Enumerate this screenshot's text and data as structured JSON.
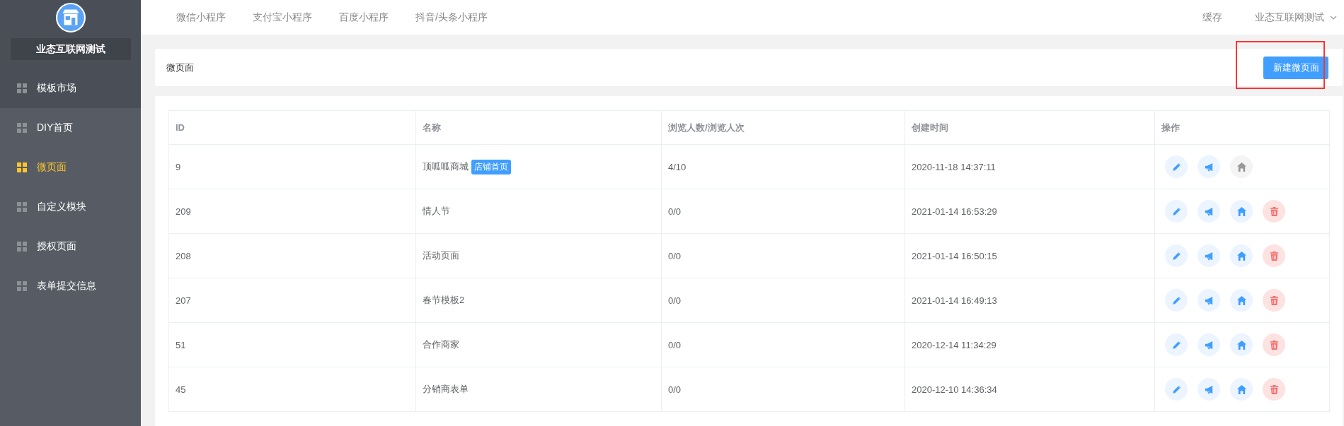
{
  "sidebar": {
    "shop_name": "业态互联网测试",
    "items": [
      {
        "label": "模板市场",
        "selected": false,
        "hovered": true
      },
      {
        "label": "DIY首页",
        "selected": false,
        "hovered": false
      },
      {
        "label": "微页面",
        "selected": true,
        "hovered": false
      },
      {
        "label": "自定义模块",
        "selected": false,
        "hovered": false
      },
      {
        "label": "授权页面",
        "selected": false,
        "hovered": false
      },
      {
        "label": "表单提交信息",
        "selected": false,
        "hovered": false
      }
    ]
  },
  "top_nav": {
    "tabs": [
      "微信小程序",
      "支付宝小程序",
      "百度小程序",
      "抖音/头条小程序"
    ],
    "cache": "缓存",
    "account": "业态互联网测试"
  },
  "page_header": {
    "title": "微页面",
    "new_button": "新建微页面",
    "highlighted": true
  },
  "table": {
    "columns": [
      "ID",
      "名称",
      "浏览人数/浏览人次",
      "创建时间",
      "操作"
    ],
    "rows": [
      {
        "id": "9",
        "name": "顶呱呱商城",
        "tag": "店铺首页",
        "views": "4/10",
        "created": "2020-11-18 14:37:11",
        "actions": [
          {
            "kind": "edit",
            "disabled": false
          },
          {
            "kind": "promote",
            "disabled": false
          },
          {
            "kind": "home",
            "disabled": true
          }
        ]
      },
      {
        "id": "209",
        "name": "情人节",
        "views": "0/0",
        "created": "2021-01-14 16:53:29",
        "actions": [
          {
            "kind": "edit",
            "disabled": false
          },
          {
            "kind": "promote",
            "disabled": false
          },
          {
            "kind": "home",
            "disabled": false
          },
          {
            "kind": "delete",
            "disabled": false
          }
        ]
      },
      {
        "id": "208",
        "name": "活动页面",
        "views": "0/0",
        "created": "2021-01-14 16:50:15",
        "actions": [
          {
            "kind": "edit",
            "disabled": false
          },
          {
            "kind": "promote",
            "disabled": false
          },
          {
            "kind": "home",
            "disabled": false
          },
          {
            "kind": "delete",
            "disabled": false
          }
        ]
      },
      {
        "id": "207",
        "name": "春节模板2",
        "views": "0/0",
        "created": "2021-01-14 16:49:13",
        "actions": [
          {
            "kind": "edit",
            "disabled": false
          },
          {
            "kind": "promote",
            "disabled": false
          },
          {
            "kind": "home",
            "disabled": false
          },
          {
            "kind": "delete",
            "disabled": false
          }
        ]
      },
      {
        "id": "51",
        "name": "合作商家",
        "views": "0/0",
        "created": "2020-12-14 11:34:29",
        "actions": [
          {
            "kind": "edit",
            "disabled": false
          },
          {
            "kind": "promote",
            "disabled": false
          },
          {
            "kind": "home",
            "disabled": false
          },
          {
            "kind": "delete",
            "disabled": false
          }
        ]
      },
      {
        "id": "45",
        "name": "分销商表单",
        "views": "0/0",
        "created": "2020-12-10 14:36:34",
        "actions": [
          {
            "kind": "edit",
            "disabled": false
          },
          {
            "kind": "promote",
            "disabled": false
          },
          {
            "kind": "home",
            "disabled": false
          },
          {
            "kind": "delete",
            "disabled": false
          }
        ]
      }
    ]
  }
}
